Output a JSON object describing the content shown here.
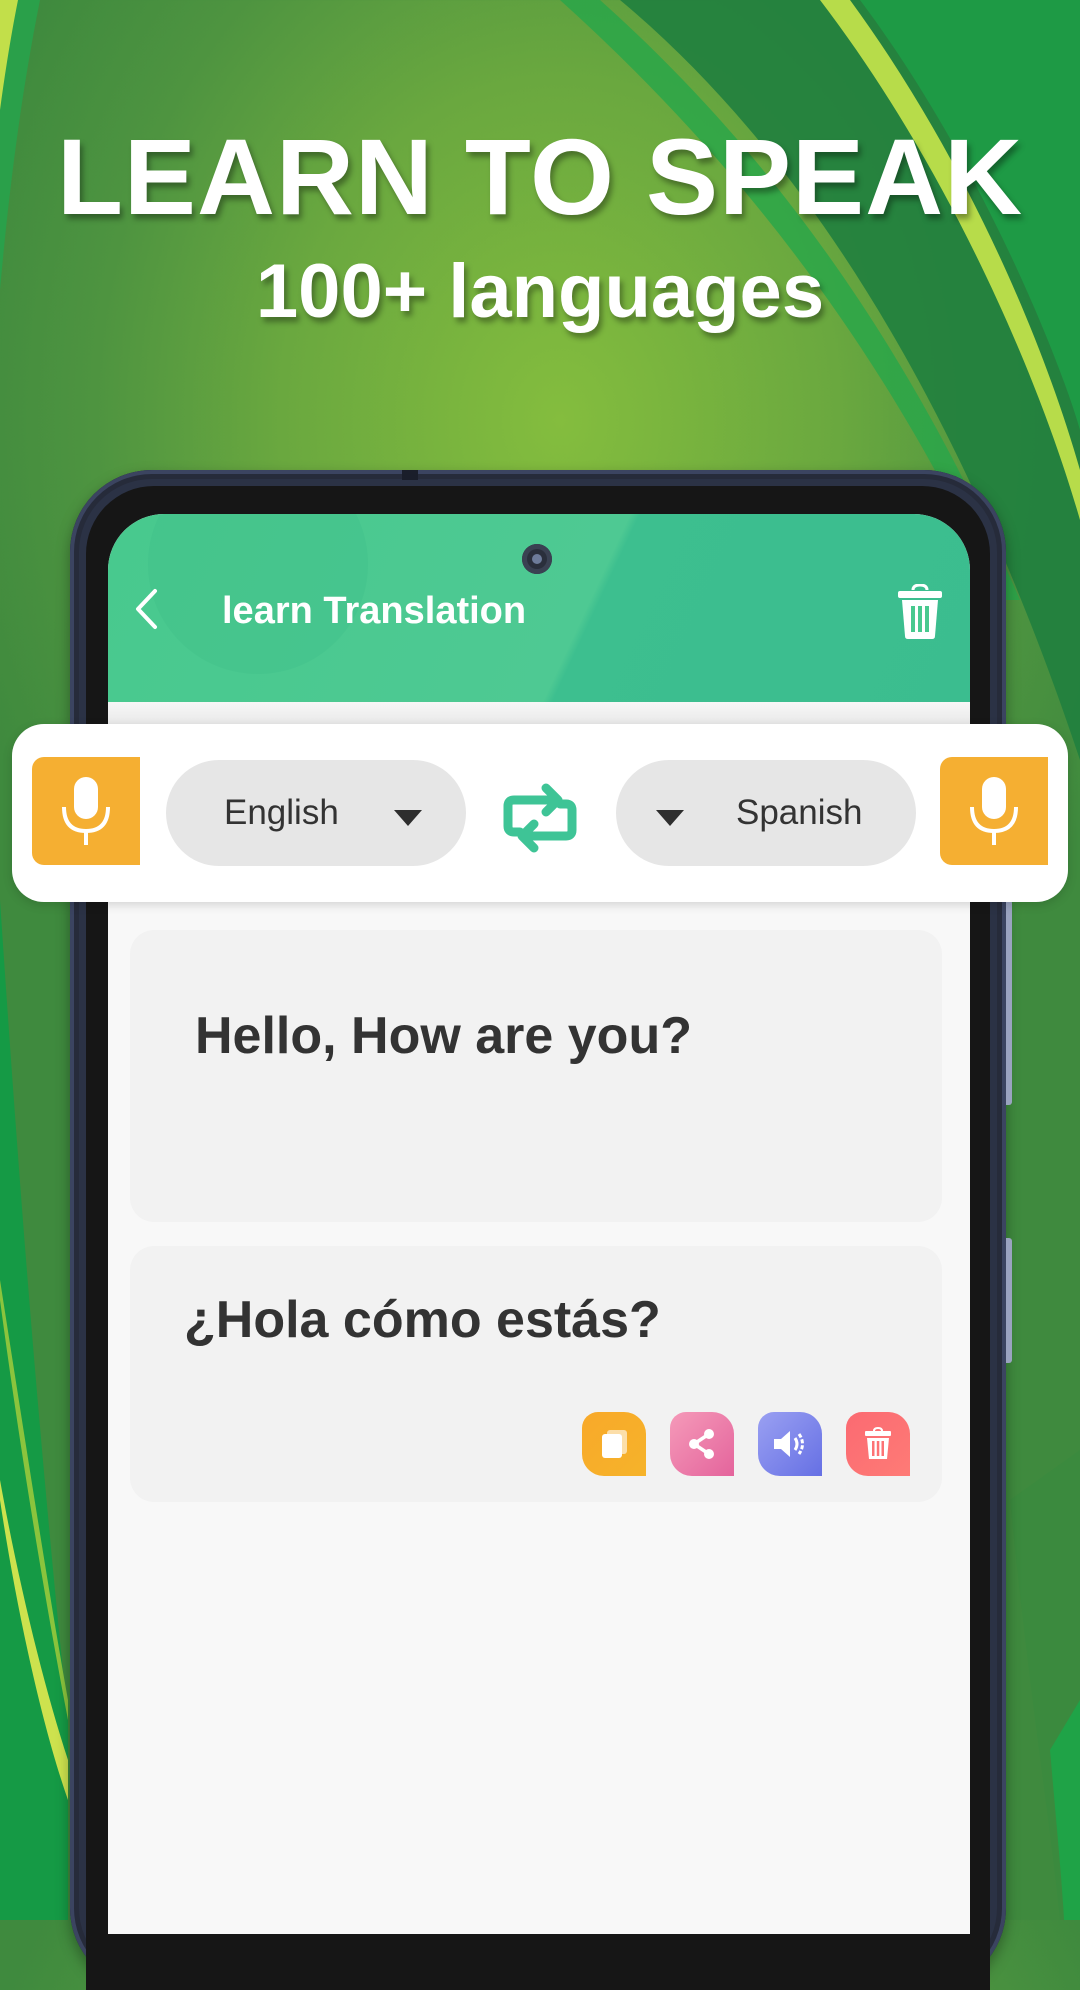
{
  "promo": {
    "headline": "LEARN TO SPEAK",
    "subheadline": "100+ languages"
  },
  "app": {
    "title": "learn Translation",
    "icons": {
      "back": "chevron-left-icon",
      "delete_all": "trash-icon",
      "mic": "microphone-icon",
      "swap": "swap-arrows-icon",
      "dropdown": "caret-down-icon",
      "copy": "copy-icon",
      "share": "share-icon",
      "speak": "speaker-icon",
      "delete": "trash-icon"
    }
  },
  "language_bar": {
    "source_language": "English",
    "target_language": "Spanish"
  },
  "translation": {
    "source_text": "Hello, How are you?",
    "translated_text": "¿Hola cómo estás?"
  },
  "colors": {
    "appbar": "#48c98e",
    "accent_green": "#3ec496",
    "mic_orange": "#f5af32",
    "copy_orange": "#f8a92a",
    "share_pink": "#e96fa3",
    "speak_blue": "#7a82ea",
    "delete_red": "#fd7274",
    "text_dark": "#333333"
  }
}
